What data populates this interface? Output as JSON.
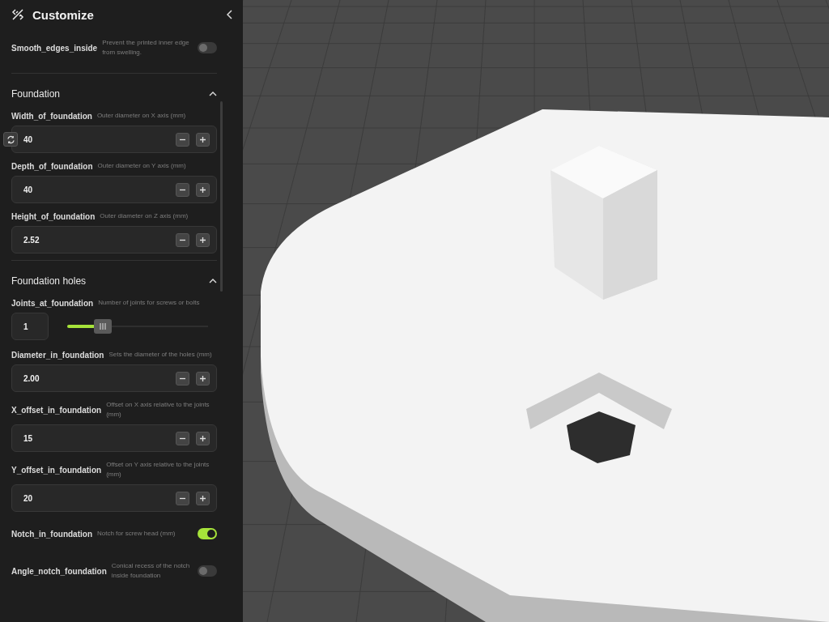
{
  "panel": {
    "title": "Customize"
  },
  "items": [
    {
      "kind": "toggle",
      "label": "Smooth_edges_inside",
      "description": "Prevent the printed inner edge from swelling.",
      "on": false
    }
  ],
  "sections": [
    {
      "title": "Foundation",
      "expanded": true,
      "items": [
        {
          "kind": "number",
          "label": "Width_of_foundation",
          "description": "Outer diameter on X axis (mm)",
          "value": "40",
          "reset": true
        },
        {
          "kind": "number",
          "label": "Depth_of_foundation",
          "description": "Outer diameter on Y axis (mm)",
          "value": "40",
          "reset": false
        },
        {
          "kind": "number",
          "label": "Height_of_foundation",
          "description": "Outer diameter on Z axis (mm)",
          "value": "2.52",
          "reset": false
        }
      ]
    },
    {
      "title": "Foundation holes",
      "expanded": true,
      "items": [
        {
          "kind": "slider",
          "label": "Joints_at_foundation",
          "description": "Number of joints for screws or bolts",
          "value": "1",
          "level": 0.25
        },
        {
          "kind": "number",
          "label": "Diameter_in_foundation",
          "description": "Sets the diameter of the holes (mm)",
          "value": "2.00",
          "reset": false
        },
        {
          "kind": "number",
          "label": "X_offset_in_foundation",
          "description": "Offset on X axis relative to the joints (mm)",
          "value": "15",
          "reset": false
        },
        {
          "kind": "number",
          "label": "Y_offset_in_foundation",
          "description": "Offset on Y axis relative to the joints (mm)",
          "value": "20",
          "reset": false
        },
        {
          "kind": "toggle",
          "label": "Notch_in_foundation",
          "description": "Notch for screw head (mm)",
          "on": true
        },
        {
          "kind": "toggle",
          "label": "Angle_notch_foundation",
          "description": "Conical recess of the notch inside foundation",
          "on": false
        }
      ]
    }
  ]
}
